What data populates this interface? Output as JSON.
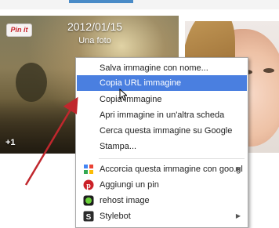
{
  "photo_card": {
    "pin_label": "Pin it",
    "date": "2012/01/15",
    "caption": "Una foto",
    "count_badge": "+1"
  },
  "context_menu": {
    "items": [
      {
        "label": "Salva immagine con nome...",
        "highlighted": false
      },
      {
        "label": "Copia URL immagine",
        "highlighted": true
      },
      {
        "label": "Copia immagine",
        "highlighted": false
      },
      {
        "label": "Apri immagine in un'altra scheda",
        "highlighted": false
      },
      {
        "label": "Cerca questa immagine su Google",
        "highlighted": false
      },
      {
        "label": "Stampa...",
        "highlighted": false
      }
    ],
    "extensions": [
      {
        "label": "Accorcia questa immagine con goo.gl",
        "icon": "googl-icon",
        "submenu": true
      },
      {
        "label": "Aggiungi un pin",
        "icon": "pinterest-icon",
        "submenu": false
      },
      {
        "label": "rehost image",
        "icon": "rehost-icon",
        "submenu": false
      },
      {
        "label": "Stylebot",
        "icon": "stylebot-icon",
        "submenu": true
      }
    ],
    "highlight_color": "#4a7fe0"
  },
  "annotation": {
    "arrow_color": "#c0272d"
  }
}
